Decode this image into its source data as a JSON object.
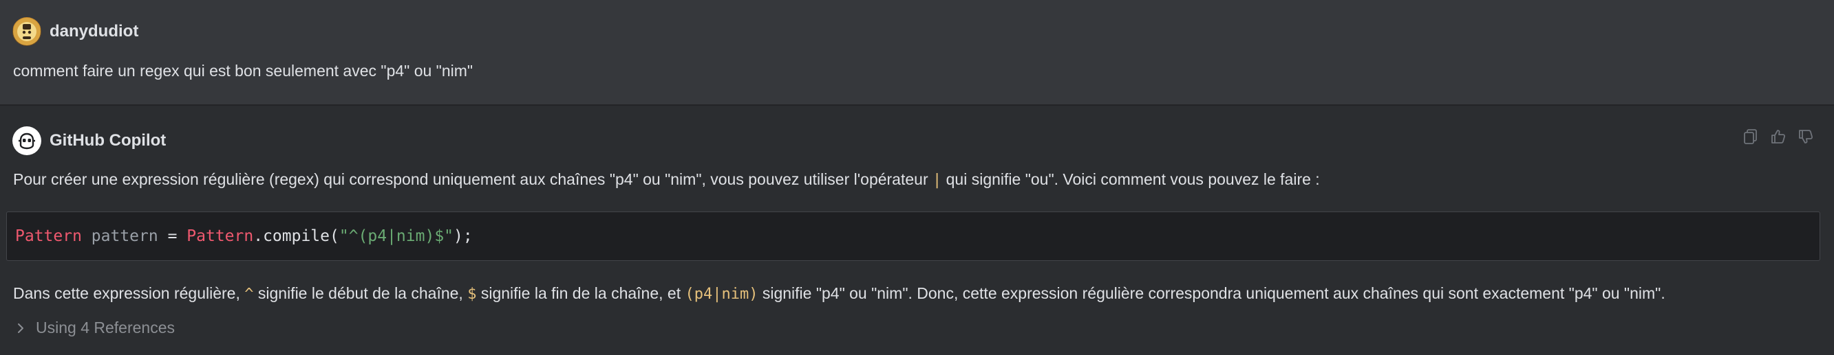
{
  "user_message": {
    "author": "danydudiot",
    "avatar_icon": "user-avatar-icon",
    "text": "comment faire un regex qui est bon seulement avec \"p4\" ou \"nim\""
  },
  "copilot_message": {
    "author": "GitHub Copilot",
    "avatar_icon": "copilot-icon",
    "actions": {
      "copy_icon": "copy-icon",
      "thumbs_up_icon": "thumbs-up-icon",
      "thumbs_down_icon": "thumbs-down-icon"
    },
    "intro": {
      "before": "Pour créer une expression régulière (regex) qui correspond uniquement aux chaînes \"p4\" ou \"nim\", vous pouvez utiliser l'opérateur ",
      "code": "|",
      "after": " qui signifie \"ou\". Voici comment vous pouvez le faire :"
    },
    "code": {
      "type1": "Pattern",
      "var": "pattern",
      "eq": " = ",
      "type2": "Pattern",
      "call": ".compile(",
      "str": "\"^(p4|nim)$\"",
      "end": ");"
    },
    "explanation": {
      "part1": "Dans cette expression régulière, ",
      "code1": "^",
      "part2": " signifie le début de la chaîne, ",
      "code2": "$",
      "part3": " signifie la fin de la chaîne, et ",
      "code3": "(p4|nim)",
      "part4": " signifie \"p4\" ou \"nim\". Donc, cette expression régulière correspondra uniquement aux chaînes qui sont exactement \"p4\" ou \"nim\"."
    },
    "references": {
      "label": "Using 4 References",
      "icon": "chevron-right-icon"
    }
  },
  "colors": {
    "background": "#2b2d30",
    "user_background": "#36383c",
    "code_background": "#1e1f22",
    "keyword": "#ef596f",
    "string": "#6aab73",
    "inline_code": "#e5c07b"
  }
}
